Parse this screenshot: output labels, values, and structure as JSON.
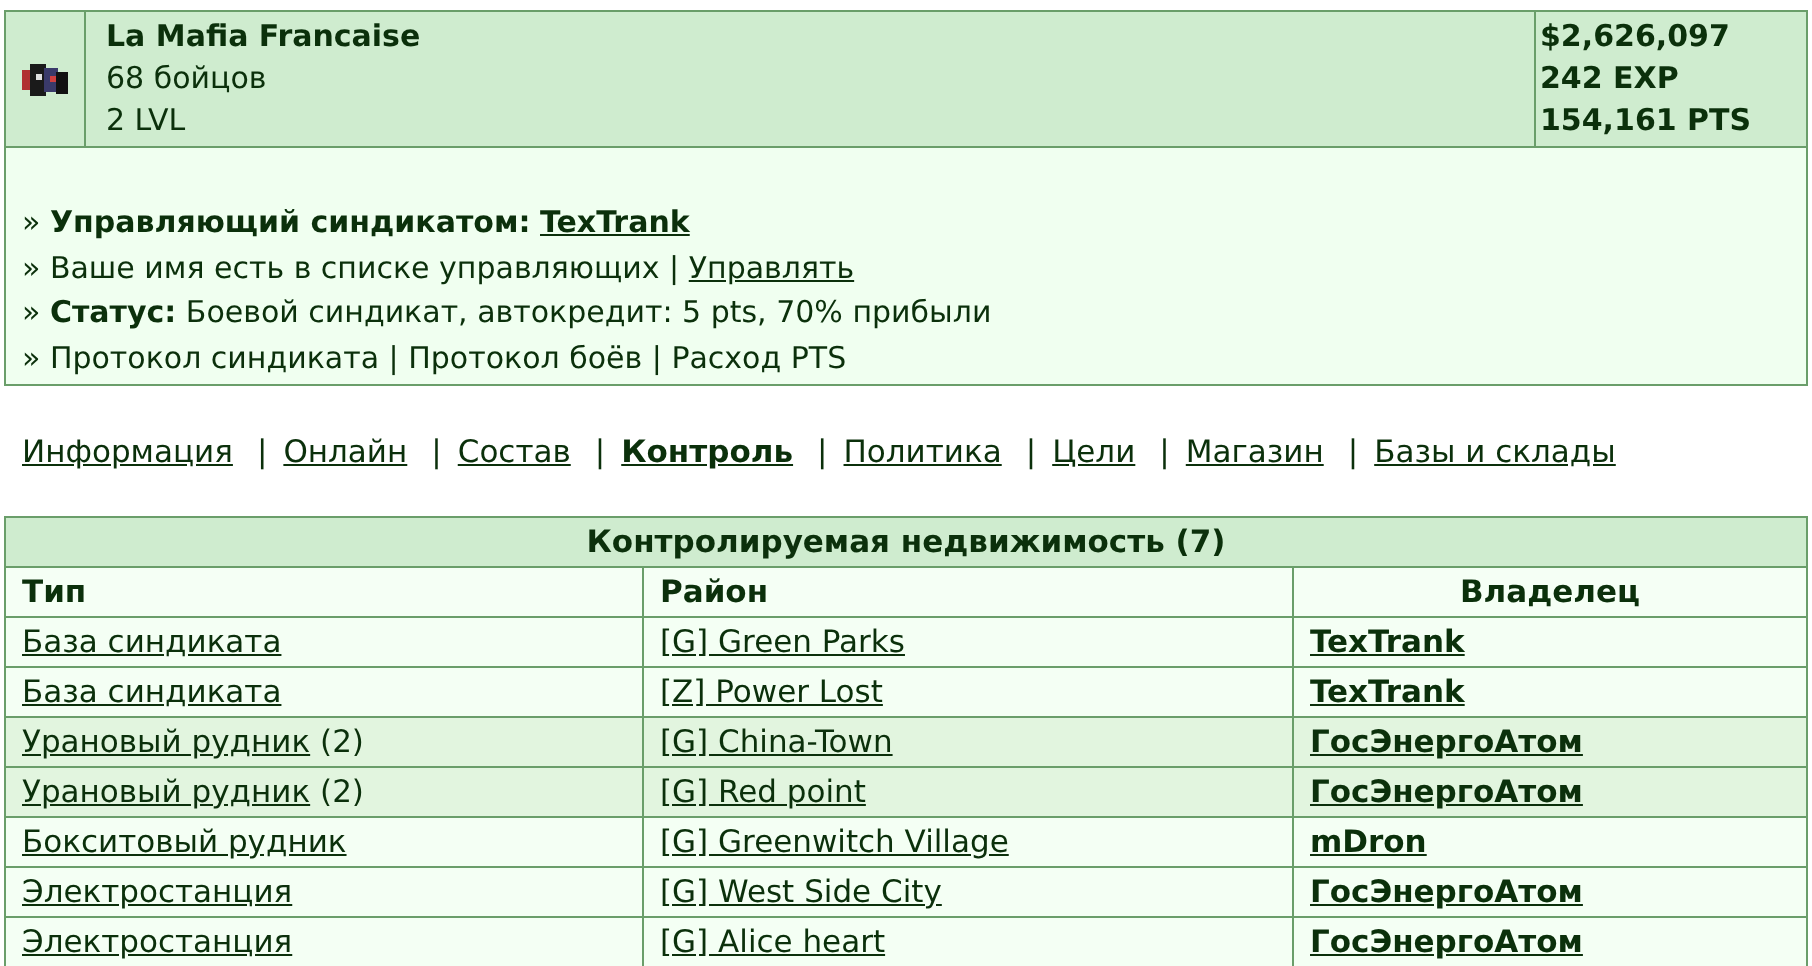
{
  "syndicate": {
    "name": "La Mafia Francaise",
    "fighters": "68 бойцов",
    "level": "2 LVL",
    "money": "$2,626,097",
    "exp": "242 EXP",
    "pts": "154,161 PTS"
  },
  "info_lines": [
    [
      {
        "kind": "text",
        "text": "» **Управляющий синдикатом:** "
      },
      {
        "kind": "link",
        "text": "TexTrank",
        "bold": true
      }
    ],
    [
      {
        "kind": "text",
        "text": "» Ваше имя есть в списке управляющих | "
      },
      {
        "kind": "link",
        "text": "Управлять",
        "bold": false
      }
    ],
    [
      {
        "kind": "text",
        "text": "» **Статус:** Боевой синдикат, автокредит: 5 pts, 70% прибыли"
      }
    ],
    [
      {
        "kind": "text",
        "text": "» Протокол синдиката | Протокол боёв | Расход PTS"
      }
    ]
  ],
  "nav": {
    "separator": "|",
    "items": [
      {
        "label": "Информация",
        "selected": false
      },
      {
        "label": "Онлайн",
        "selected": false
      },
      {
        "label": "Состав",
        "selected": false
      },
      {
        "label": "Контроль",
        "selected": true
      },
      {
        "label": "Политика",
        "selected": false
      },
      {
        "label": "Цели",
        "selected": false
      },
      {
        "label": "Магазин",
        "selected": false
      },
      {
        "label": "Базы и склады",
        "selected": false
      }
    ]
  },
  "table": {
    "title": "Контролируемая недвижимость (7)",
    "columns": [
      "Тип",
      "Район",
      "Владелец"
    ],
    "rows": [
      {
        "type": "База синдиката",
        "count": null,
        "district": "[G] Green Parks",
        "owner": "TexTrank",
        "highlighted": false
      },
      {
        "type": "База синдиката",
        "count": null,
        "district": "[Z] Power Lost",
        "owner": "TexTrank",
        "highlighted": false
      },
      {
        "type": "Урановый рудник",
        "count": "(2)",
        "district": "[G] China-Town",
        "owner": "ГосЭнергоАтом",
        "highlighted": true
      },
      {
        "type": "Урановый рудник",
        "count": "(2)",
        "district": "[G] Red point",
        "owner": "ГосЭнергоАтом",
        "highlighted": true
      },
      {
        "type": "Бокситовый рудник",
        "count": null,
        "district": "[G] Greenwitch Village",
        "owner": "mDron",
        "highlighted": false
      },
      {
        "type": "Электростанция",
        "count": null,
        "district": "[G] West Side City",
        "owner": "ГосЭнергоАтом",
        "highlighted": false
      },
      {
        "type": "Электростанция",
        "count": null,
        "district": "[G] Alice heart",
        "owner": "ГосЭнергоАтом",
        "highlighted": false
      }
    ]
  }
}
